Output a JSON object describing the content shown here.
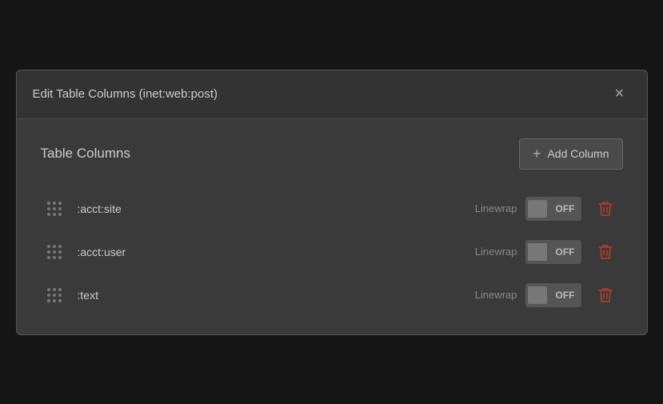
{
  "modal": {
    "title": "Edit Table Columns (inet:web:post)",
    "close_label": "×"
  },
  "section": {
    "title": "Table Columns",
    "add_button_label": "Add Column"
  },
  "columns": [
    {
      "id": "col-1",
      "name": ":acct:site",
      "linewrap_label": "Linewrap",
      "toggle_state": "OFF"
    },
    {
      "id": "col-2",
      "name": ":acct:user",
      "linewrap_label": "Linewrap",
      "toggle_state": "OFF"
    },
    {
      "id": "col-3",
      "name": ":text",
      "linewrap_label": "Linewrap",
      "toggle_state": "OFF"
    }
  ],
  "colors": {
    "delete": "#c0392b",
    "toggle_off": "#666"
  }
}
